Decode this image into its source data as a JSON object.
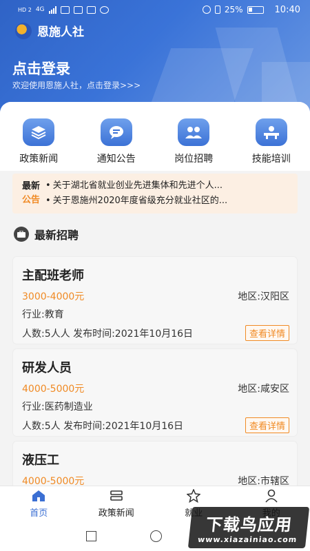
{
  "statusbar": {
    "network_left": "HD 2",
    "network_type": "4G",
    "battery_percent": "25%",
    "time": "10:40"
  },
  "header": {
    "app_title": "恩施人社",
    "login_title": "点击登录",
    "login_subtitle": "欢迎使用恩施人社，点击登录>>>",
    "brand_color": "#3a73d8"
  },
  "quick_nav": [
    {
      "label": "政策新闻",
      "icon": "layers-icon"
    },
    {
      "label": "通知公告",
      "icon": "message-icon"
    },
    {
      "label": "岗位招聘",
      "icon": "people-icon"
    },
    {
      "label": "技能培训",
      "icon": "training-icon"
    }
  ],
  "news": {
    "badge_line1": "最新",
    "badge_line2": "公告",
    "items": [
      "关于湖北省就业创业先进集体和先进个人...",
      "关于恩施州2020年度省级充分就业社区的..."
    ]
  },
  "section": {
    "title": "最新招聘"
  },
  "jobs": [
    {
      "title": "主配班老师",
      "salary": "3000-4000元",
      "area": "地区:汉阳区",
      "industry": "行业:教育",
      "meta": "人数:5人人  发布时间:2021年10月16日",
      "detail_label": "查看详情"
    },
    {
      "title": "研发人员",
      "salary": "4000-5000元",
      "area": "地区:咸安区",
      "industry": "行业:医药制造业",
      "meta": "人数:5人   发布时间:2021年10月16日",
      "detail_label": "查看详情"
    },
    {
      "title": "液压工",
      "salary": "4000-5000元",
      "area": "地区:市辖区",
      "industry": "",
      "meta": "",
      "detail_label": ""
    }
  ],
  "tabbar": [
    {
      "label": "首页",
      "icon": "home-icon",
      "active": true
    },
    {
      "label": "政策新闻",
      "icon": "news-icon",
      "active": false
    },
    {
      "label": "就业",
      "icon": "star-icon",
      "active": false
    },
    {
      "label": "我的",
      "icon": "user-icon",
      "active": false
    }
  ],
  "watermark": {
    "main": "下载鸟应用",
    "url": "www.xiazainiao.com"
  }
}
